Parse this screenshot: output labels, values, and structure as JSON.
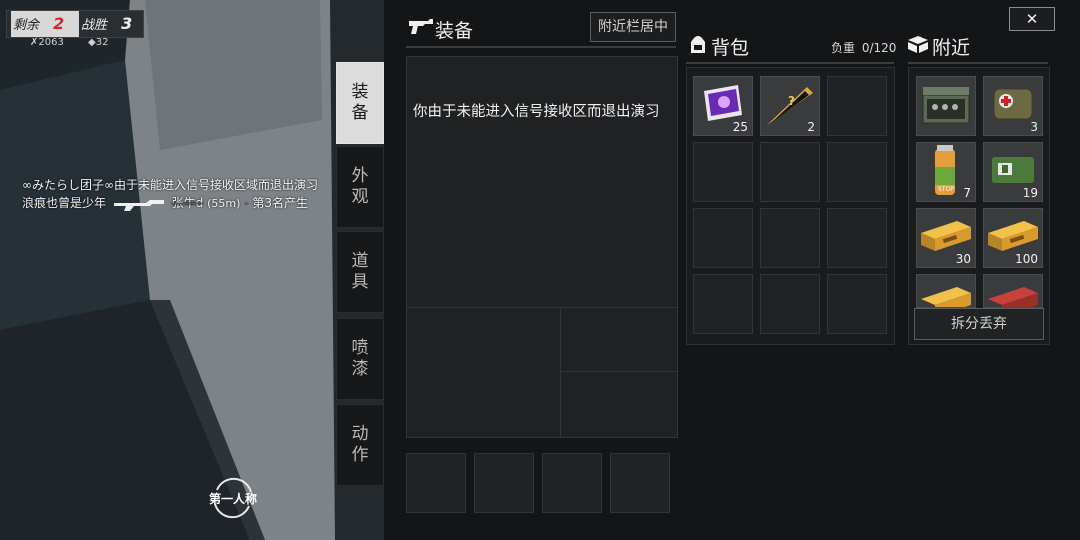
{
  "hud": {
    "remaining_label": "剩余",
    "remaining_value": "2",
    "wins_label": "战胜",
    "wins_value": "3",
    "kills": "2063",
    "armor": "32"
  },
  "killfeed": [
    {
      "text": "∞みたらし团子∞由于未能进入信号接收区域而退出演习"
    },
    {
      "player": "浪痕也曾是少年",
      "victim": "张牛d",
      "distance": "(55m)",
      "dash": "-",
      "rank": "第3名产生"
    }
  ],
  "tabs": [
    {
      "label": "装备",
      "active": true
    },
    {
      "label": "外观",
      "active": false
    },
    {
      "label": "道具",
      "active": false
    },
    {
      "label": "喷漆",
      "active": false
    },
    {
      "label": "动作",
      "active": false
    }
  ],
  "perspective_label": "第一人称",
  "equipment": {
    "title": "装备",
    "nearby_btn": "附近栏居中",
    "message": "你由于未能进入信号接收区而退出演习"
  },
  "backpack": {
    "title": "背包",
    "weight_label": "负重",
    "weight_value": "0/120",
    "items": [
      {
        "icon": "photo-card-icon",
        "qty": "25"
      },
      {
        "icon": "mystery-pennant-icon",
        "qty": "2"
      }
    ]
  },
  "nearby": {
    "title": "附近",
    "items": [
      {
        "icon": "supply-crate-icon",
        "qty": ""
      },
      {
        "icon": "medkit-bag-icon",
        "qty": "3"
      },
      {
        "icon": "energy-drink-icon",
        "qty": "7"
      },
      {
        "icon": "bandage-icon",
        "qty": "19"
      },
      {
        "icon": "ammo-box-icon",
        "qty": "30"
      },
      {
        "icon": "ammo-box-icon",
        "qty": "100"
      },
      {
        "icon": "ammo-box-icon",
        "qty": ""
      },
      {
        "icon": "shell-box-icon",
        "qty": ""
      }
    ],
    "split_discard": "拆分丢弃"
  },
  "close_label": "✕"
}
